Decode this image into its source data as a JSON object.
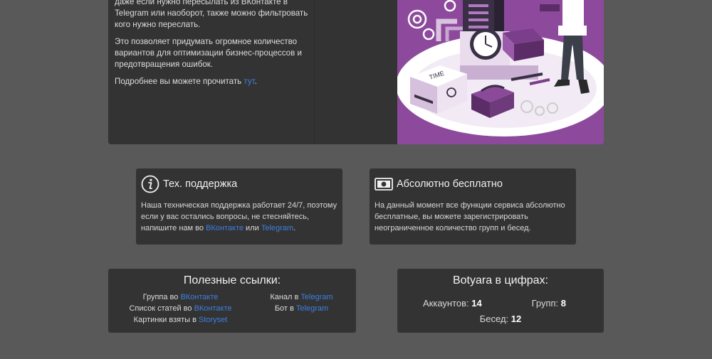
{
  "top": {
    "paragraphs": [
      {
        "text": "даже если нужно пересылать из ВКонтакте в Telegram или наоборот, также можно фильтровать кого нужно переслать."
      },
      {
        "text": "Это позволяет придумать огромное количество вариантов для оптимизации бизнес-процессов и предотвращения ошибок."
      }
    ],
    "more_prefix": "Подробнее вы можете прочитать ",
    "more_link": "тут",
    "more_suffix": ".",
    "illustration_label": "TIME"
  },
  "support": {
    "icon": "info-icon",
    "title": "Тех. поддержка",
    "body_prefix": "Наша техническая поддержка работает 24/7, поэтому если у вас остались вопросы, не стесняйтесь, напишите нам во ",
    "link_vk": "ВКонтакте",
    "body_mid": " или ",
    "link_tg": "Telegram",
    "body_suffix": "."
  },
  "free": {
    "icon": "money-icon",
    "title": "Абсолютно бесплатно",
    "body": "На данный момент все функции сервиса абсолютно бесплатные, вы можете зарегистрировать неограниченное количество групп и бесед."
  },
  "links": {
    "title": "Полезные ссылки:",
    "left": [
      {
        "prefix": "Группа во ",
        "link": "ВКонтакте"
      },
      {
        "prefix": "Список статей во ",
        "link": "ВКонтакте"
      },
      {
        "prefix": "Картинки взяты в ",
        "link": "Storyset"
      }
    ],
    "right": [
      {
        "prefix": "Канал в ",
        "link": "Telegram"
      },
      {
        "prefix": "Бот в ",
        "link": "Telegram"
      }
    ]
  },
  "stats": {
    "title": "Botyara в цифрах:",
    "accounts_label": "Аккаунтов: ",
    "accounts_value": "14",
    "groups_label": "Групп: ",
    "groups_value": "8",
    "chats_label": "Бесед: ",
    "chats_value": "12"
  },
  "colors": {
    "accent": "#3d7fe0",
    "background": "#595959",
    "card": "#333333",
    "illustration": "#8d4a9c"
  }
}
